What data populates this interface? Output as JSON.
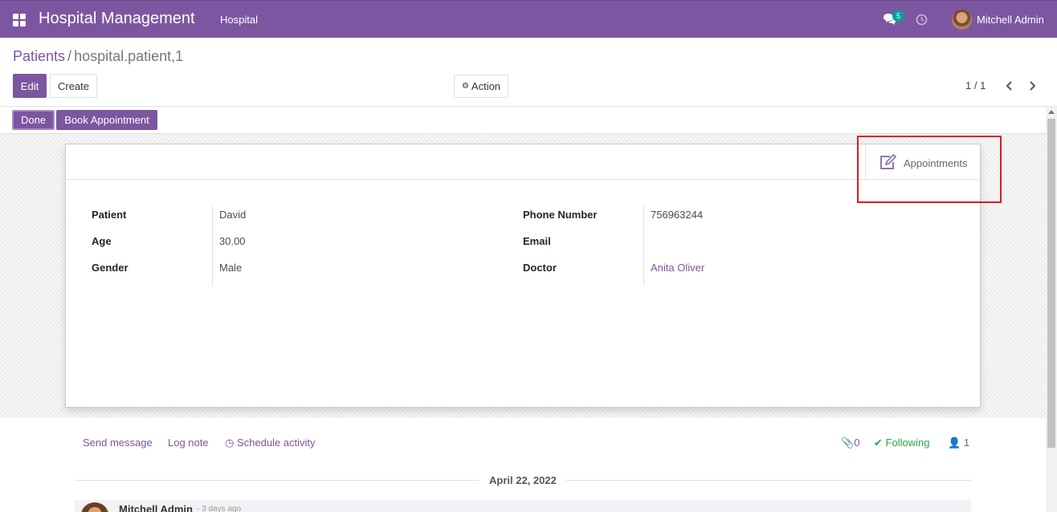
{
  "navbar": {
    "app_title": "Hospital Management",
    "menu_item": "Hospital",
    "chat_count": "5",
    "user_name": "Mitchell Admin"
  },
  "breadcrumb": {
    "parent": "Patients",
    "separator": "/",
    "current": "hospital.patient,1"
  },
  "toolbar": {
    "edit_label": "Edit",
    "create_label": "Create",
    "action_label": "Action",
    "pager": "1 / 1"
  },
  "statusbar": {
    "done_label": "Done",
    "book_label": "Book Appointment"
  },
  "smart_button": {
    "label": "Appointments"
  },
  "form": {
    "patient_label": "Patient",
    "patient_value": "David",
    "age_label": "Age",
    "age_value": "30.00",
    "gender_label": "Gender",
    "gender_value": "Male",
    "phone_label": "Phone Number",
    "phone_value": "756963244",
    "email_label": "Email",
    "email_value": "",
    "doctor_label": "Doctor",
    "doctor_value": "Anita Oliver"
  },
  "chatter": {
    "send_message": "Send message",
    "log_note": "Log note",
    "schedule_activity": "Schedule activity",
    "attachments_count": "0",
    "following_label": "Following",
    "followers_count": "1",
    "date_separator": "April 22, 2022",
    "message_author": "Mitchell Admin",
    "message_time": "- 3 days ago"
  },
  "colors": {
    "brand": "#7c56a0",
    "following": "#28a745",
    "highlight": "#e0181e"
  }
}
